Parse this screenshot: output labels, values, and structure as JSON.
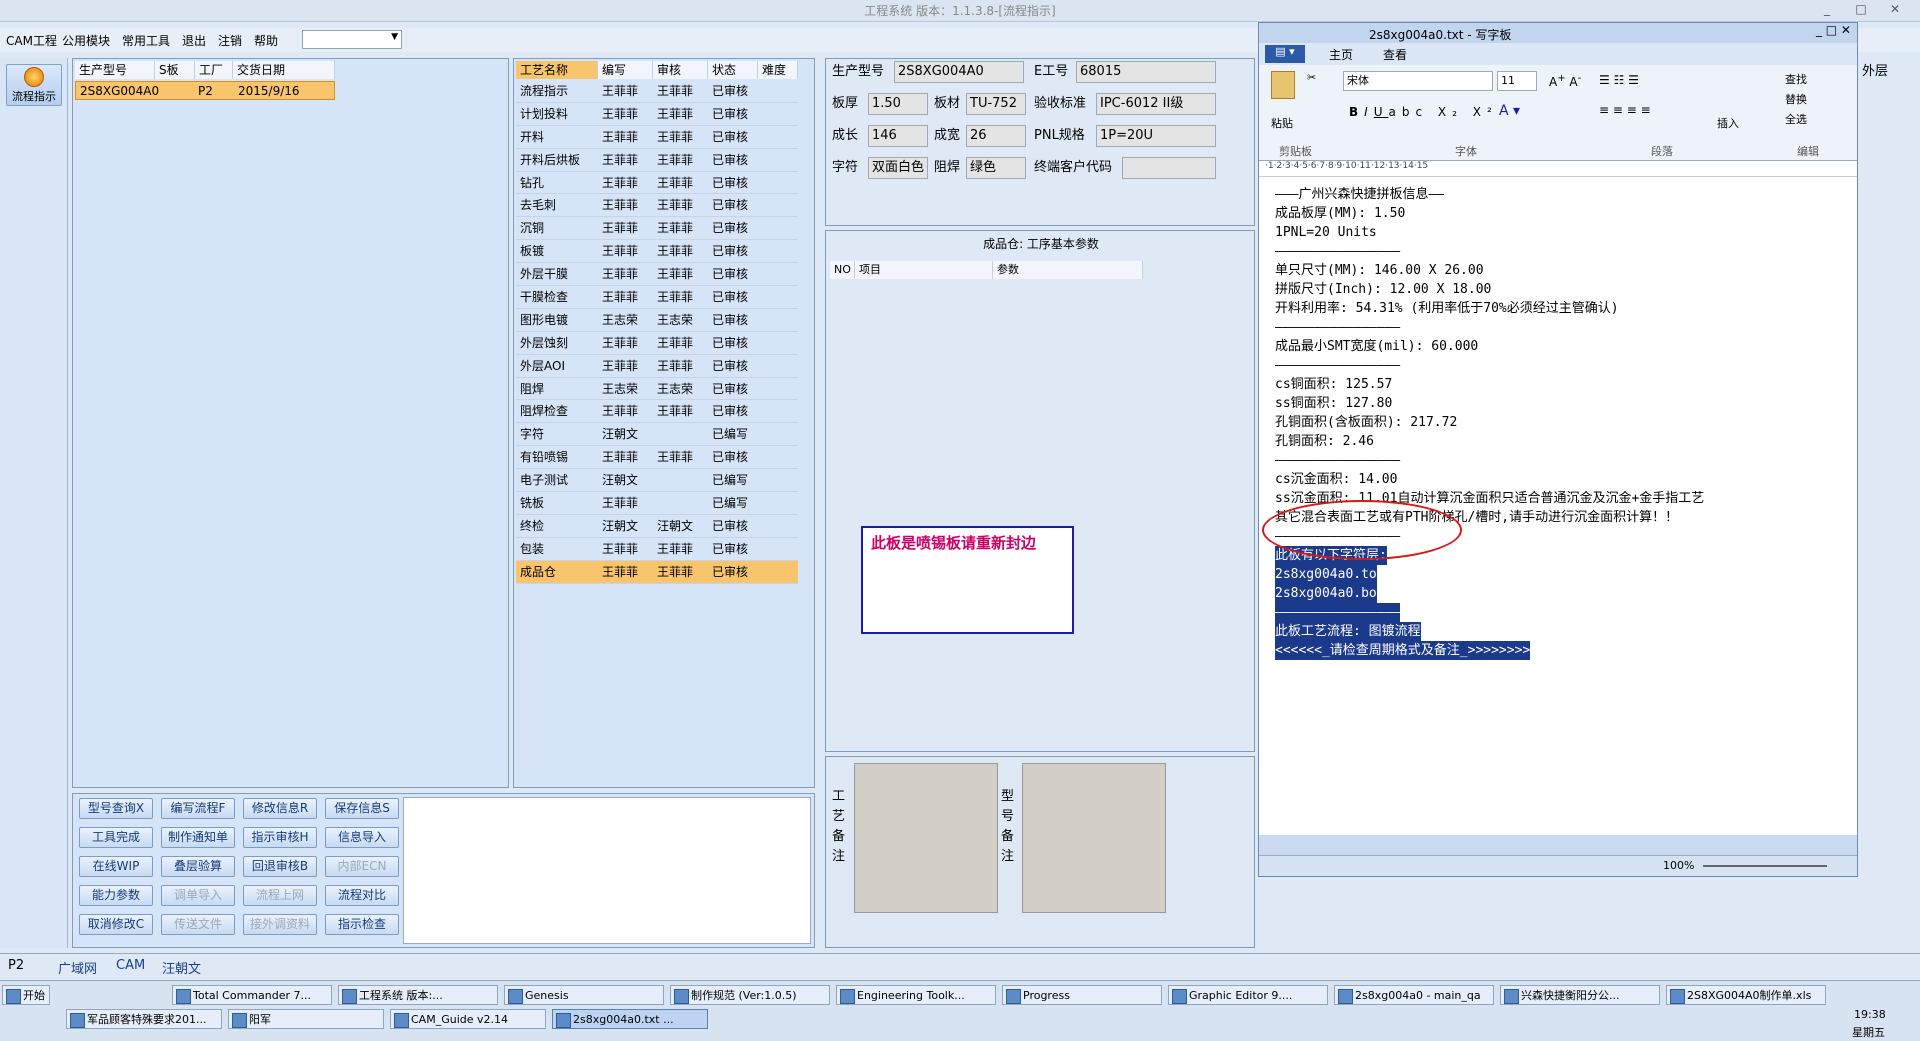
{
  "titlebar": {
    "title": "工程系统 版本：1.1.3.8-[流程指示]"
  },
  "menu": [
    "CAM工程",
    "公用模块",
    "常用工具",
    "退出",
    "注销",
    "帮助"
  ],
  "left": {
    "flow_button": "流程指示"
  },
  "product_table": {
    "headers": [
      "生产型号",
      "S板",
      "工厂",
      "交货日期"
    ],
    "row": [
      "2S8XG004A0",
      "",
      "P2",
      "2015/9/16"
    ]
  },
  "process_table": {
    "headers": [
      "工艺名称",
      "编写",
      "审核",
      "状态",
      "难度"
    ],
    "rows": [
      [
        "流程指示",
        "王菲菲",
        "王菲菲",
        "已审核"
      ],
      [
        "计划投料",
        "王菲菲",
        "王菲菲",
        "已审核"
      ],
      [
        "开料",
        "王菲菲",
        "王菲菲",
        "已审核"
      ],
      [
        "开料后烘板",
        "王菲菲",
        "王菲菲",
        "已审核"
      ],
      [
        "钻孔",
        "王菲菲",
        "王菲菲",
        "已审核"
      ],
      [
        "去毛刺",
        "王菲菲",
        "王菲菲",
        "已审核"
      ],
      [
        "沉铜",
        "王菲菲",
        "王菲菲",
        "已审核"
      ],
      [
        "板镀",
        "王菲菲",
        "王菲菲",
        "已审核"
      ],
      [
        "外层干膜",
        "王菲菲",
        "王菲菲",
        "已审核"
      ],
      [
        "干膜检查",
        "王菲菲",
        "王菲菲",
        "已审核"
      ],
      [
        "图形电镀",
        "王志荣",
        "王志荣",
        "已审核"
      ],
      [
        "外层蚀刻",
        "王菲菲",
        "王菲菲",
        "已审核"
      ],
      [
        "外层AOI",
        "王菲菲",
        "王菲菲",
        "已审核"
      ],
      [
        "阻焊",
        "王志荣",
        "王志荣",
        "已审核"
      ],
      [
        "阻焊检查",
        "王菲菲",
        "王菲菲",
        "已审核"
      ],
      [
        "字符",
        "汪朝文",
        "",
        "已编写"
      ],
      [
        "有铅喷锡",
        "王菲菲",
        "王菲菲",
        "已审核"
      ],
      [
        "电子测试",
        "汪朝文",
        "",
        "已编写"
      ],
      [
        "铣板",
        "王菲菲",
        "",
        "已编写"
      ],
      [
        "终检",
        "汪朝文",
        "汪朝文",
        "已审核"
      ],
      [
        "包装",
        "王菲菲",
        "王菲菲",
        "已审核"
      ],
      [
        "成品仓",
        "王菲菲",
        "王菲菲",
        "已审核"
      ]
    ]
  },
  "buttons": [
    [
      "型号查询X",
      "编写流程F",
      "修改信息R",
      "保存信息S"
    ],
    [
      "工具完成",
      "制作通知单",
      "指示审核H",
      "信息导入"
    ],
    [
      "在线WIP",
      "叠层验算",
      "回退审核B",
      "内部ECN"
    ],
    [
      "能力参数",
      "调单导入",
      "流程上网",
      "流程对比"
    ],
    [
      "取消修改C",
      "传送文件",
      "接外调资料",
      "指示检查"
    ]
  ],
  "info": {
    "labels": [
      "生产型号",
      "E工号",
      "板厚",
      "板材",
      "验收标准",
      "成长",
      "成宽",
      "PNL规格",
      "字符",
      "阻焊",
      "终端客户代码"
    ],
    "values": {
      "model": "2S8XG004A0",
      "eno": "68015",
      "thickness": "1.50",
      "material": "TU-752",
      "standard": "IPC-6012 II级",
      "length": "146",
      "width": "26",
      "pnl": "1P=20U",
      "char": "双面白色",
      "mask": "绿色",
      "client": ""
    }
  },
  "params": {
    "title": "成品仓: 工序基本参数",
    "headers": [
      "NO",
      "项目",
      "参数"
    ]
  },
  "note": "此板是喷锡板请重新封边",
  "remarks": {
    "process": "工艺备注",
    "model": "型号备注"
  },
  "bottom_tabs": [
    "P2",
    "广域网",
    "CAM",
    "汪朝文"
  ],
  "wordpad": {
    "title": "2s8xg004a0.txt - 写字板",
    "tabs": [
      "主页",
      "查看"
    ],
    "font": "宋体",
    "size": "11",
    "groups": [
      "剪贴板",
      "字体",
      "段落",
      "编辑"
    ],
    "paste": "粘贴",
    "insert": "插入",
    "find": "查找",
    "replace": "替换",
    "selectall": "全选",
    "zoom": "100%",
    "lines": [
      "———广州兴森快捷拼板信息——",
      "成品板厚(MM): 1.50",
      "1PNL=20 Units",
      "————————————————",
      "单只尺寸(MM): 146.00 X 26.00",
      "拼版尺寸(Inch): 12.00 X 18.00",
      "开料利用率: 54.31% (利用率低于70%必须经过主管确认)",
      "————————————————",
      "成品最小SMT宽度(mil): 60.000",
      "————————————————",
      "cs铜面积: 125.57",
      "ss铜面积: 127.80",
      "孔铜面积(含板面积): 217.72",
      "孔铜面积: 2.46",
      "————————————————",
      "cs沉金面积: 14.00",
      "ss沉金面积: 11.01自动计算沉金面积只适合普通沉金及沉金+金手指工艺",
      "其它混合表面工艺或有PTH阶梯孔/槽时,请手动进行沉金面积计算！！",
      "————————————————",
      "此板有以下字符层:",
      "2s8xg004a0.to",
      "2s8xg004a0.bo",
      "————————————————",
      "此板工艺流程: 图镀流程",
      "<<<<<<_请检查周期格式及备注_>>>>>>>>"
    ]
  },
  "right_edge": "外层",
  "taskbar": {
    "start": "开始",
    "row1": [
      "Total Commander 7...",
      "工程系统  版本:...",
      "Genesis",
      "制作规范 (Ver:1.0.5)",
      "Engineering Toolk...",
      "Progress",
      "Graphic Editor 9....",
      "2s8xg004a0 - main_qa",
      "兴森快捷衡阳分公...",
      "2S8XG004A0制作单.xls"
    ],
    "row2": [
      "军品顾客特殊要求201...",
      "阳军",
      "CAM_Guide v2.14",
      "2s8xg004a0.txt ..."
    ],
    "time": "19:38",
    "day": "星期五"
  }
}
